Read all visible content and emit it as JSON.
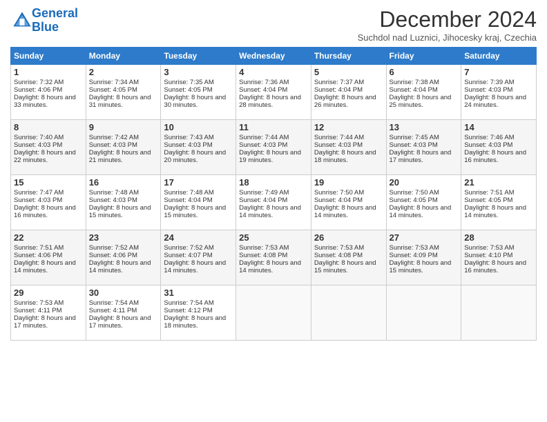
{
  "logo": {
    "line1": "General",
    "line2": "Blue"
  },
  "title": "December 2024",
  "subtitle": "Suchdol nad Luznici, Jihocesky kraj, Czechia",
  "days_of_week": [
    "Sunday",
    "Monday",
    "Tuesday",
    "Wednesday",
    "Thursday",
    "Friday",
    "Saturday"
  ],
  "weeks": [
    [
      {
        "day": 1,
        "rise": "7:32 AM",
        "set": "4:06 PM",
        "daylight": "8 hours and 33 minutes."
      },
      {
        "day": 2,
        "rise": "7:34 AM",
        "set": "4:05 PM",
        "daylight": "8 hours and 31 minutes."
      },
      {
        "day": 3,
        "rise": "7:35 AM",
        "set": "4:05 PM",
        "daylight": "8 hours and 30 minutes."
      },
      {
        "day": 4,
        "rise": "7:36 AM",
        "set": "4:04 PM",
        "daylight": "8 hours and 28 minutes."
      },
      {
        "day": 5,
        "rise": "7:37 AM",
        "set": "4:04 PM",
        "daylight": "8 hours and 26 minutes."
      },
      {
        "day": 6,
        "rise": "7:38 AM",
        "set": "4:04 PM",
        "daylight": "8 hours and 25 minutes."
      },
      {
        "day": 7,
        "rise": "7:39 AM",
        "set": "4:03 PM",
        "daylight": "8 hours and 24 minutes."
      }
    ],
    [
      {
        "day": 8,
        "rise": "7:40 AM",
        "set": "4:03 PM",
        "daylight": "8 hours and 22 minutes."
      },
      {
        "day": 9,
        "rise": "7:42 AM",
        "set": "4:03 PM",
        "daylight": "8 hours and 21 minutes."
      },
      {
        "day": 10,
        "rise": "7:43 AM",
        "set": "4:03 PM",
        "daylight": "8 hours and 20 minutes."
      },
      {
        "day": 11,
        "rise": "7:44 AM",
        "set": "4:03 PM",
        "daylight": "8 hours and 19 minutes."
      },
      {
        "day": 12,
        "rise": "7:44 AM",
        "set": "4:03 PM",
        "daylight": "8 hours and 18 minutes."
      },
      {
        "day": 13,
        "rise": "7:45 AM",
        "set": "4:03 PM",
        "daylight": "8 hours and 17 minutes."
      },
      {
        "day": 14,
        "rise": "7:46 AM",
        "set": "4:03 PM",
        "daylight": "8 hours and 16 minutes."
      }
    ],
    [
      {
        "day": 15,
        "rise": "7:47 AM",
        "set": "4:03 PM",
        "daylight": "8 hours and 16 minutes."
      },
      {
        "day": 16,
        "rise": "7:48 AM",
        "set": "4:03 PM",
        "daylight": "8 hours and 15 minutes."
      },
      {
        "day": 17,
        "rise": "7:48 AM",
        "set": "4:04 PM",
        "daylight": "8 hours and 15 minutes."
      },
      {
        "day": 18,
        "rise": "7:49 AM",
        "set": "4:04 PM",
        "daylight": "8 hours and 14 minutes."
      },
      {
        "day": 19,
        "rise": "7:50 AM",
        "set": "4:04 PM",
        "daylight": "8 hours and 14 minutes."
      },
      {
        "day": 20,
        "rise": "7:50 AM",
        "set": "4:05 PM",
        "daylight": "8 hours and 14 minutes."
      },
      {
        "day": 21,
        "rise": "7:51 AM",
        "set": "4:05 PM",
        "daylight": "8 hours and 14 minutes."
      }
    ],
    [
      {
        "day": 22,
        "rise": "7:51 AM",
        "set": "4:06 PM",
        "daylight": "8 hours and 14 minutes."
      },
      {
        "day": 23,
        "rise": "7:52 AM",
        "set": "4:06 PM",
        "daylight": "8 hours and 14 minutes."
      },
      {
        "day": 24,
        "rise": "7:52 AM",
        "set": "4:07 PM",
        "daylight": "8 hours and 14 minutes."
      },
      {
        "day": 25,
        "rise": "7:53 AM",
        "set": "4:08 PM",
        "daylight": "8 hours and 14 minutes."
      },
      {
        "day": 26,
        "rise": "7:53 AM",
        "set": "4:08 PM",
        "daylight": "8 hours and 15 minutes."
      },
      {
        "day": 27,
        "rise": "7:53 AM",
        "set": "4:09 PM",
        "daylight": "8 hours and 15 minutes."
      },
      {
        "day": 28,
        "rise": "7:53 AM",
        "set": "4:10 PM",
        "daylight": "8 hours and 16 minutes."
      }
    ],
    [
      {
        "day": 29,
        "rise": "7:53 AM",
        "set": "4:11 PM",
        "daylight": "8 hours and 17 minutes."
      },
      {
        "day": 30,
        "rise": "7:54 AM",
        "set": "4:11 PM",
        "daylight": "8 hours and 17 minutes."
      },
      {
        "day": 31,
        "rise": "7:54 AM",
        "set": "4:12 PM",
        "daylight": "8 hours and 18 minutes."
      },
      null,
      null,
      null,
      null
    ]
  ]
}
